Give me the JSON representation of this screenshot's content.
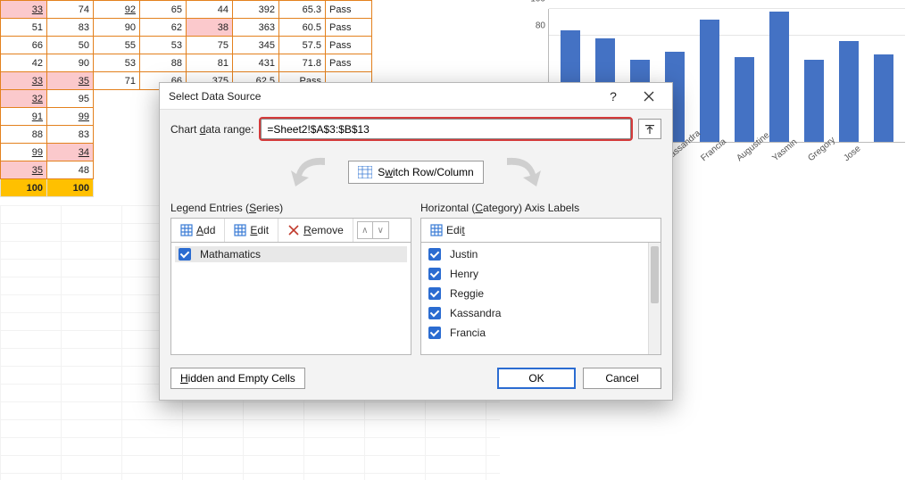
{
  "sheet": {
    "rows": [
      {
        "cells": [
          "33",
          "74",
          "92",
          "65",
          "44",
          "392",
          "65.3",
          "Pass"
        ],
        "pink": [
          0
        ],
        "under": [
          0,
          2
        ]
      },
      {
        "cells": [
          "51",
          "83",
          "90",
          "62",
          "38",
          "363",
          "60.5",
          "Pass"
        ],
        "pink": [
          4
        ]
      },
      {
        "cells": [
          "66",
          "50",
          "55",
          "53",
          "75",
          "345",
          "57.5",
          "Pass"
        ]
      },
      {
        "cells": [
          "42",
          "90",
          "53",
          "88",
          "81",
          "431",
          "71.8",
          "Pass"
        ]
      },
      {
        "cells": [
          "33",
          "35",
          "71",
          "66",
          "375",
          "62.5",
          "Pass",
          ""
        ],
        "pink": [
          0,
          1
        ],
        "under": [
          0,
          1
        ]
      },
      {
        "cells": [
          "32",
          "95"
        ],
        "pink": [
          0
        ],
        "under": [
          0
        ]
      },
      {
        "cells": [
          "91",
          "99"
        ],
        "under": [
          0,
          1
        ]
      },
      {
        "cells": [
          "88",
          "83"
        ]
      },
      {
        "cells": [
          "99",
          "34"
        ],
        "pink": [
          1
        ],
        "under": [
          0,
          1
        ]
      },
      {
        "cells": [
          "35",
          "48"
        ],
        "pink": [
          0
        ],
        "under": [
          0
        ]
      }
    ],
    "totals": [
      "100",
      "100"
    ]
  },
  "chart_data": {
    "type": "bar",
    "categories": [
      "Justin",
      "Henry",
      "Reggie",
      "Kassandra",
      "Francia",
      "Augustine",
      "Yasmin",
      "Gregory",
      "Jose",
      ""
    ],
    "values": [
      84,
      78,
      62,
      68,
      92,
      64,
      98,
      62,
      76,
      66
    ],
    "series_name": "Mathamatics",
    "ylim": [
      0,
      100
    ],
    "yticks": [
      80,
      100
    ],
    "ylabel": "",
    "xlabel": "",
    "title": ""
  },
  "dialog": {
    "title": "Select Data Source",
    "range_label_pre": "Chart ",
    "range_label_u": "d",
    "range_label_post": "ata range:",
    "range_value": "=Sheet2!$A$3:$B$13",
    "switch_label_pre": "S",
    "switch_label_u": "w",
    "switch_label_post": "itch Row/Column",
    "legend": {
      "title_pre": "Legend Entries (",
      "title_u": "S",
      "title_post": "eries)",
      "add_u": "A",
      "add_post": "dd",
      "edit_u": "E",
      "edit_post": "dit",
      "remove_u": "R",
      "remove_post": "emove",
      "items": [
        "Mathamatics"
      ]
    },
    "axis": {
      "title_pre": "Horizontal (",
      "title_u": "C",
      "title_post": "ategory) Axis Labels",
      "edit_label_pre": "Edi",
      "edit_label_u": "t",
      "items": [
        "Justin",
        "Henry",
        "Reggie",
        "Kassandra",
        "Francia"
      ]
    },
    "hidden_pre": "",
    "hidden_u": "H",
    "hidden_post": "idden and Empty Cells",
    "ok": "OK",
    "cancel": "Cancel"
  }
}
